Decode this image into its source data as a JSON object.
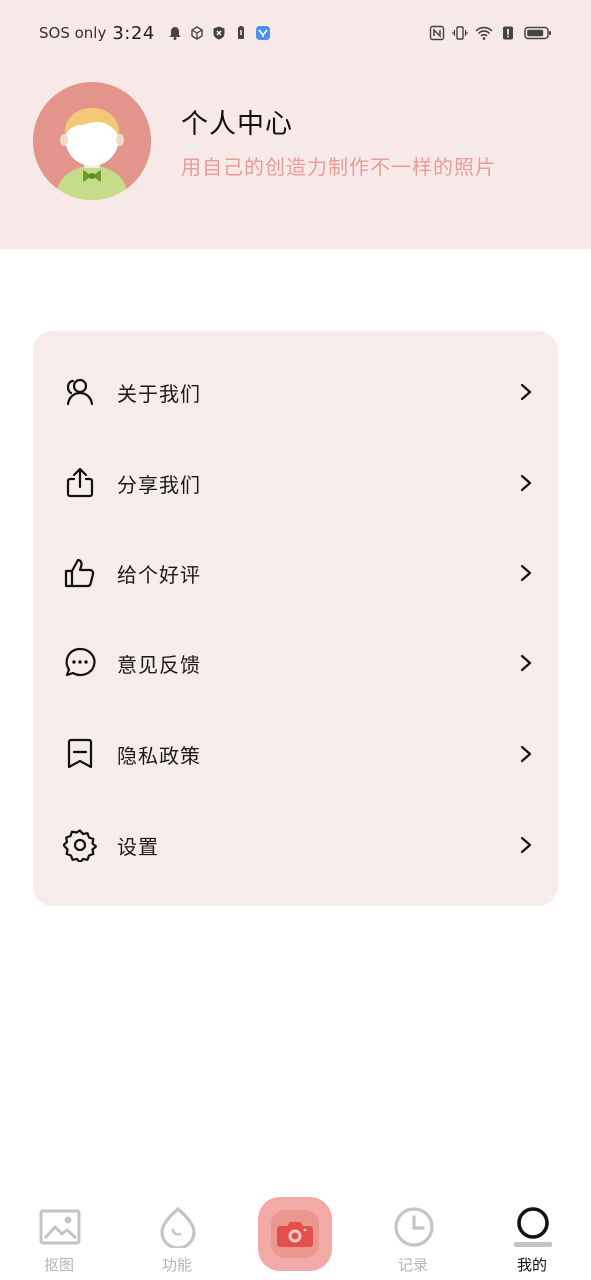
{
  "status_bar": {
    "carrier": "SOS only",
    "time": "3:24"
  },
  "profile": {
    "title": "个人中心",
    "subtitle": "用自己的创造力制作不一样的照片"
  },
  "menu": {
    "items": [
      {
        "label": "关于我们",
        "icon": "users-icon"
      },
      {
        "label": "分享我们",
        "icon": "share-icon"
      },
      {
        "label": "给个好评",
        "icon": "thumbs-up-icon"
      },
      {
        "label": "意见反馈",
        "icon": "chat-bubble-icon"
      },
      {
        "label": "隐私政策",
        "icon": "bookmark-icon"
      },
      {
        "label": "设置",
        "icon": "gear-icon"
      }
    ]
  },
  "tabbar": {
    "tabs": [
      {
        "label": "抠图",
        "icon": "image-icon",
        "active": false
      },
      {
        "label": "功能",
        "icon": "drop-icon",
        "active": false
      },
      {
        "label": "",
        "icon": "camera-icon",
        "active": false
      },
      {
        "label": "记录",
        "icon": "clock-icon",
        "active": false
      },
      {
        "label": "我的",
        "icon": "profile-ring-icon",
        "active": true
      }
    ]
  },
  "colors": {
    "header_bg": "#f7e9e8",
    "card_bg": "#f6eceb",
    "accent": "#ea9c97",
    "camera_bg": "#f2aaa6",
    "inactive_tab": "#b5b5b5"
  }
}
